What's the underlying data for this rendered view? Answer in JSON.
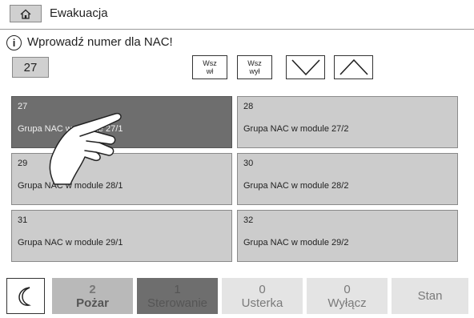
{
  "header": {
    "title": "Ewakuacja",
    "home_icon": "home-icon"
  },
  "prompt": {
    "text": "Wprowadź numer dla NAC!",
    "icon": "info-icon",
    "icon_glyph": "i"
  },
  "number_input": {
    "value": "27"
  },
  "buttons": {
    "all_on": {
      "line1": "Wsz",
      "line2": "wł"
    },
    "all_off": {
      "line1": "Wsz",
      "line2": "wył"
    },
    "down_icon": "chevron-down-icon",
    "up_icon": "chevron-up-icon"
  },
  "tiles": [
    {
      "number": "27",
      "label": "Grupa NAC w module 27/1",
      "selected": true
    },
    {
      "number": "28",
      "label": "Grupa NAC w module 27/2",
      "selected": false
    },
    {
      "number": "29",
      "label": "Grupa NAC w module 28/1",
      "selected": false
    },
    {
      "number": "30",
      "label": "Grupa NAC w module 28/2",
      "selected": false
    },
    {
      "number": "31",
      "label": "Grupa NAC w module 29/1",
      "selected": false
    },
    {
      "number": "32",
      "label": "Grupa NAC w module 29/2",
      "selected": false
    }
  ],
  "bottom_bar": {
    "night_icon": "moon-icon",
    "fire": {
      "count": "2",
      "label": "Pożar"
    },
    "control": {
      "count": "1",
      "label": "Sterowanie"
    },
    "fault": {
      "count": "0",
      "label": "Usterka"
    },
    "disable": {
      "count": "0",
      "label": "Wyłącz"
    },
    "state": {
      "label": "Stan"
    }
  },
  "colors": {
    "selected_tile": "#6e6e6e",
    "tile": "#cccccc",
    "bottom_inactive": "#e4e4e4"
  }
}
